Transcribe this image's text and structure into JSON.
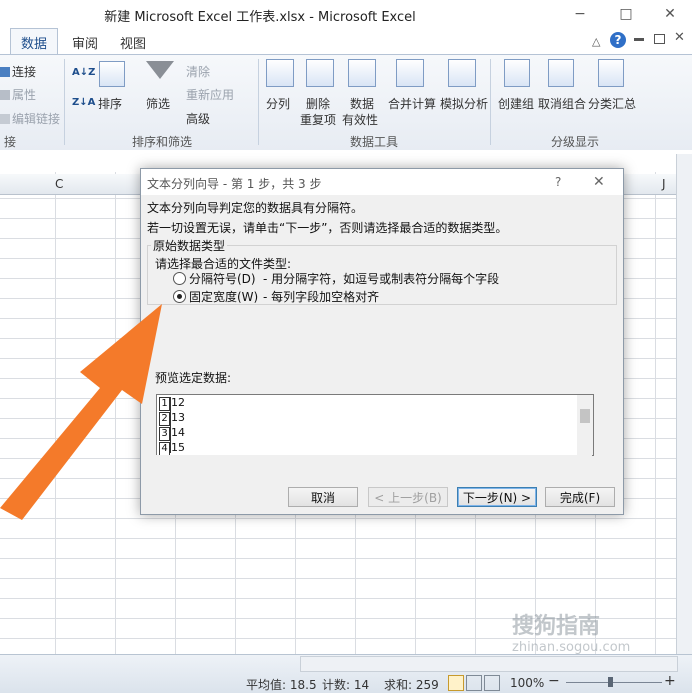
{
  "window": {
    "title": "新建 Microsoft Excel 工作表.xlsx  -  Microsoft Excel",
    "minimize": "−",
    "maximize": "□",
    "close": "✕"
  },
  "ribbon": {
    "tabs": [
      {
        "label": "数据",
        "active": true
      },
      {
        "label": "审阅",
        "active": false
      },
      {
        "label": "视图",
        "active": false
      }
    ],
    "right_icons": [
      "caret-up-icon",
      "help-icon",
      "window-restore-icon",
      "close-icon"
    ],
    "help": "?",
    "caret": "△",
    "connections": {
      "items": [
        "连接",
        "属性",
        "编辑链接"
      ],
      "label": "接"
    },
    "sort_filter": {
      "sort_asc": "A↓Z",
      "sort_desc": "Z↓A",
      "sort": "排序",
      "filter": "筛选",
      "clear": "清除",
      "reapply": "重新应用",
      "advanced": "高级",
      "label": "排序和筛选"
    },
    "data_tools": {
      "split": "分列",
      "remove_dup_1": "删除",
      "remove_dup_2": "重复项",
      "validation_1": "数据",
      "validation_2": "有效性",
      "consolidate": "合并计算",
      "what_if": "模拟分析",
      "label": "数据工具"
    },
    "outline": {
      "group": "创建组",
      "ungroup": "取消组合",
      "subtotal": "分类汇总",
      "label": "分级显示"
    }
  },
  "sheet": {
    "col_c": "C",
    "col_j": "J"
  },
  "dialog": {
    "title": "文本分列向导 - 第 1 步，共 3 步",
    "help": "?",
    "close": "✕",
    "line1": "文本分列向导判定您的数据具有分隔符。",
    "line2": "若一切设置无误，请单击“下一步”，否则请选择最合适的数据类型。",
    "group_title": "原始数据类型",
    "choose_label": "请选择最合适的文件类型:",
    "options": [
      {
        "label": "分隔符号(D)",
        "desc": "- 用分隔字符，如逗号或制表符分隔每个字段",
        "checked": false
      },
      {
        "label": "固定宽度(W)",
        "desc": "- 每列字段加空格对齐",
        "checked": true
      }
    ],
    "preview_label": "预览选定数据:",
    "preview_rows": [
      {
        "num": "1",
        "value": "12"
      },
      {
        "num": "2",
        "value": "13"
      },
      {
        "num": "3",
        "value": "14"
      },
      {
        "num": "4",
        "value": "15"
      }
    ],
    "buttons": {
      "cancel": "取消",
      "back": "< 上一步(B)",
      "next": "下一步(N) >",
      "finish": "完成(F)"
    }
  },
  "status": {
    "average": "平均值: 18.5",
    "count": "计数: 14",
    "sum": "求和: 259",
    "zoom": "100%",
    "zoom_minus": "−",
    "zoom_plus": "+"
  },
  "watermark": {
    "text": "搜狗指南",
    "url": "zhinan.sogou.com"
  },
  "colors": {
    "arrow": "#f47a2a",
    "accent": "#1e4e8c"
  }
}
